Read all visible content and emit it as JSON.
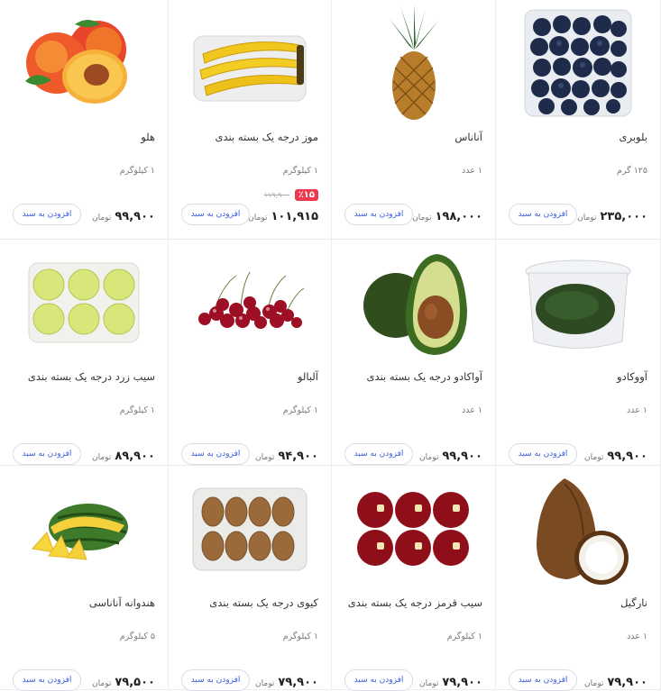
{
  "products": [
    {
      "name": "بلوبری",
      "unit": "۱۲۵ گرم",
      "price": "۲۳۵,۰۰۰",
      "currency": "تومان",
      "button": "افزودن به سبد",
      "image": "blueberry-image"
    },
    {
      "name": "آناناس",
      "unit": "۱ عدد",
      "price": "۱۹۸,۰۰۰",
      "currency": "تومان",
      "button": "افزودن به سبد",
      "image": "pineapple-image"
    },
    {
      "name": "موز درجه یک بسته بندی",
      "unit": "۱ کیلوگرم",
      "price": "۱۰۱,۹۱۵",
      "old_price": "۱۱۹,۹۰۰",
      "discount": "٪۱۵",
      "currency": "تومان",
      "button": "افزودن به سبد",
      "image": "banana-image"
    },
    {
      "name": "هلو",
      "unit": "۱ کیلوگرم",
      "price": "۹۹,۹۰۰",
      "currency": "تومان",
      "button": "افزودن به سبد",
      "image": "peach-image"
    },
    {
      "name": "آووکادو",
      "unit": "۱ عدد",
      "price": "۹۹,۹۰۰",
      "currency": "تومان",
      "button": "افزودن به سبد",
      "image": "avocado-pack-image"
    },
    {
      "name": "آواکادو درجه یک بسته بندی",
      "unit": "۱ عدد",
      "price": "۹۹,۹۰۰",
      "currency": "تومان",
      "button": "افزودن به سبد",
      "image": "avocado-image"
    },
    {
      "name": "آلبالو",
      "unit": "۱ کیلوگرم",
      "price": "۹۴,۹۰۰",
      "currency": "تومان",
      "button": "افزودن به سبد",
      "image": "cherry-image"
    },
    {
      "name": "سیب زرد درجه یک بسته بندی",
      "unit": "۱ کیلوگرم",
      "price": "۸۹,۹۰۰",
      "currency": "تومان",
      "button": "افزودن به سبد",
      "image": "yellow-apple-image"
    },
    {
      "name": "نارگیل",
      "unit": "۱ عدد",
      "price": "۷۹,۹۰۰",
      "currency": "تومان",
      "button": "افزودن به سبد",
      "image": "coconut-image"
    },
    {
      "name": "سیب قرمز درجه یک بسته بندی",
      "unit": "۱ کیلوگرم",
      "price": "۷۹,۹۰۰",
      "currency": "تومان",
      "button": "افزودن به سبد",
      "image": "red-apple-image"
    },
    {
      "name": "کیوی درجه یک بسته بندی",
      "unit": "۱ کیلوگرم",
      "price": "۷۹,۹۰۰",
      "currency": "تومان",
      "button": "افزودن به سبد",
      "image": "kiwi-image"
    },
    {
      "name": "هندوانه آناناسی",
      "unit": "۵ کیلوگرم",
      "price": "۷۹,۵۰۰",
      "currency": "تومان",
      "button": "افزودن به سبد",
      "image": "watermelon-image"
    }
  ],
  "colors": {
    "accent": "#3b5bdb",
    "discount": "#ef394e",
    "border": "#ececec"
  }
}
